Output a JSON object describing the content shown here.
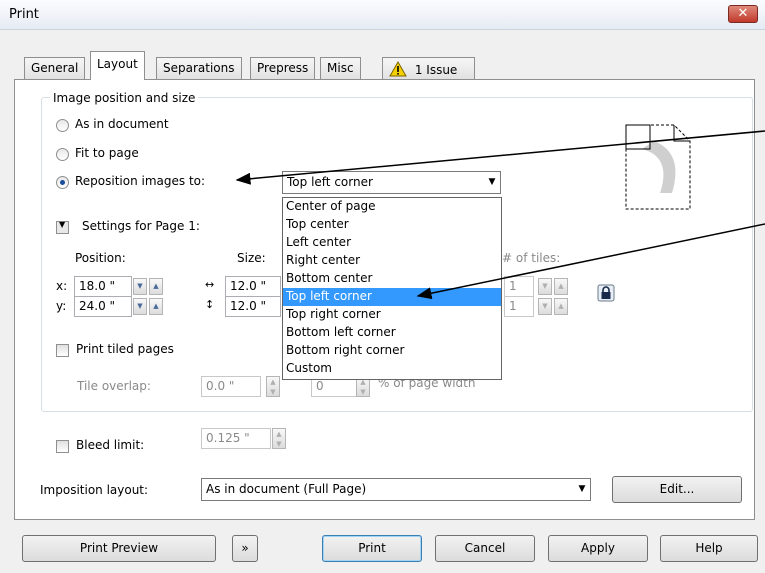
{
  "window": {
    "title": "Print",
    "close": "✕"
  },
  "tabs": [
    "General",
    "Layout",
    "Separations",
    "Prepress",
    "Misc",
    "1 Issue"
  ],
  "group": {
    "label": "Image position and size",
    "radio_as_document": "As in document",
    "radio_fit_page": "Fit to page",
    "radio_reposition": "Reposition images to:",
    "reposition_value": "Top left corner"
  },
  "dropdown": {
    "items": [
      "Center of page",
      "Top center",
      "Left center",
      "Right center",
      "Bottom center",
      "Top left corner",
      "Top right corner",
      "Bottom left corner",
      "Bottom right corner",
      "Custom"
    ],
    "selected_index": 5
  },
  "settings": {
    "label": "Settings for Page 1:",
    "position_label": "Position:",
    "size_label": "Size:",
    "tiles_label": "# of tiles:",
    "x_label": "x:",
    "y_label": "y:",
    "x_value": "18.0 \"",
    "y_value": "24.0 \"",
    "width_value": "12.0 \"",
    "height_value": "12.0 \"",
    "tiles_x": "1",
    "tiles_y": "1"
  },
  "tiled": {
    "print_tiled_label": "Print tiled pages",
    "tile_overlap_label": "Tile overlap:",
    "tile_overlap_value": "0.0 \"",
    "tile_percent_value": "0",
    "percent_label": "% of page width"
  },
  "bleed": {
    "label": "Bleed limit:",
    "value": "0.125 \""
  },
  "imposition": {
    "label": "Imposition layout:",
    "value": "As in document (Full Page)",
    "edit_button": "Edit..."
  },
  "buttons": {
    "print_preview": "Print Preview",
    "print": "Print",
    "cancel": "Cancel",
    "apply": "Apply",
    "help": "Help"
  },
  "colors": {
    "selection": "#3399ff",
    "warning": "#f5d000"
  }
}
